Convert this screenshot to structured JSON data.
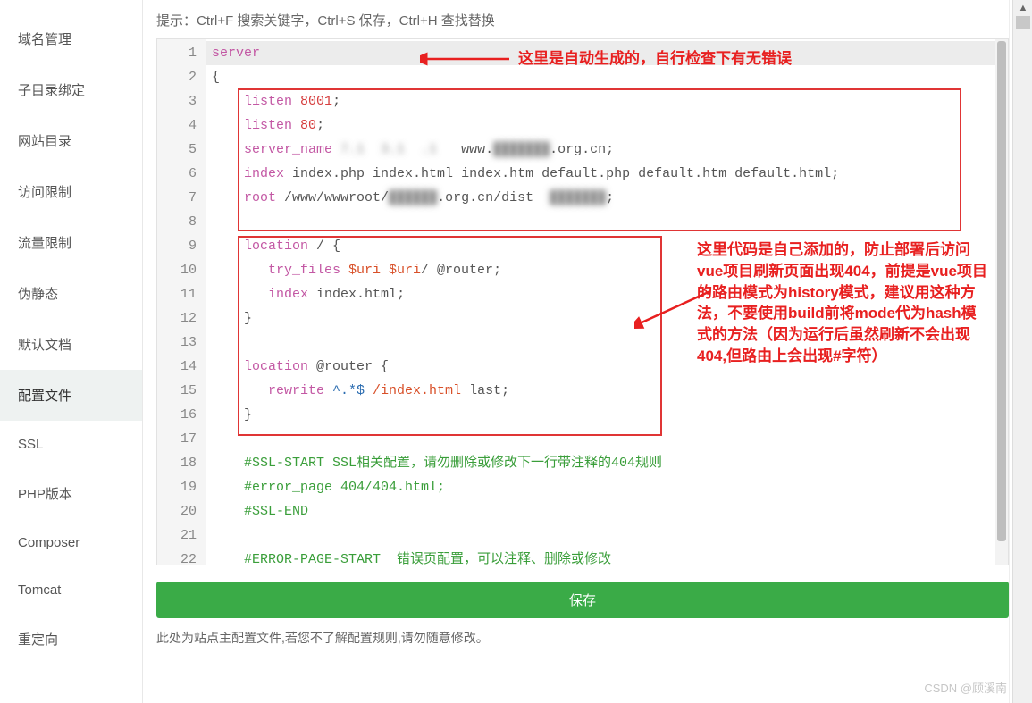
{
  "sidebar": {
    "items": [
      {
        "label": "域名管理"
      },
      {
        "label": "子目录绑定"
      },
      {
        "label": "网站目录"
      },
      {
        "label": "访问限制"
      },
      {
        "label": "流量限制"
      },
      {
        "label": "伪静态"
      },
      {
        "label": "默认文档"
      },
      {
        "label": "配置文件",
        "active": true
      },
      {
        "label": "SSL"
      },
      {
        "label": "PHP版本"
      },
      {
        "label": "Composer"
      },
      {
        "label": "Tomcat"
      },
      {
        "label": "重定向"
      }
    ]
  },
  "hint": "提示：Ctrl+F 搜索关键字，Ctrl+S 保存，Ctrl+H 查找替换",
  "save_label": "保存",
  "footer": "此处为站点主配置文件,若您不了解配置规则,请勿随意修改。",
  "annotations": {
    "top": "这里是自动生成的，自行检查下有无错误",
    "side": "这里代码是自己添加的，防止部署后访问vue项目刷新页面出现404，前提是vue项目的路由模式为history模式，建议用这种方法，不要使用build前将mode代为hash模式的方法（因为运行后虽然刷新不会出现404,但路由上会出现#字符）"
  },
  "watermark": "CSDN @顾溪南",
  "code": {
    "l1_server": "server",
    "l2_brace": "{",
    "l3_listen": "listen",
    "l3_port": "8001",
    "l4_port": "80",
    "l5_sname": "server_name",
    "l5_ip_blur": " 7.1  3.1  .1  ",
    "l5_www": " www.",
    "l5_org": ".org.cn",
    "l6_index": "index",
    "l6_files": " index.php index.html index.htm default.php default.htm default.html",
    "l7_root": "root",
    "l7_path1": " /www/wwwroot/",
    "l7_path2": ".org.cn/dist",
    "l9_loc": "location",
    "l9_slash": " / {",
    "l10_try": "try_files",
    "l10_uri": " $uri $uri",
    "l10_router": "/ @router",
    "l11_idx": "index",
    "l11_file": " index.html",
    "l12_close": "}",
    "l14_loc": "location",
    "l14_rt": " @router {",
    "l15_rw": "rewrite",
    "l15_re": " ^.*$ ",
    "l15_idx": "/index.html",
    "l15_last": " last",
    "l16_close": "}",
    "l18_ssl1": "#SSL-START SSL相关配置，请勿删除或修改下一行带注释的404规则",
    "l19_err": "#error_page 404/404.html;",
    "l20_ssl2": "#SSL-END",
    "l22_err1": "#ERROR-PAGE-START",
    "l22_err2": "  错误页配置，可以注释、删除或修改"
  }
}
